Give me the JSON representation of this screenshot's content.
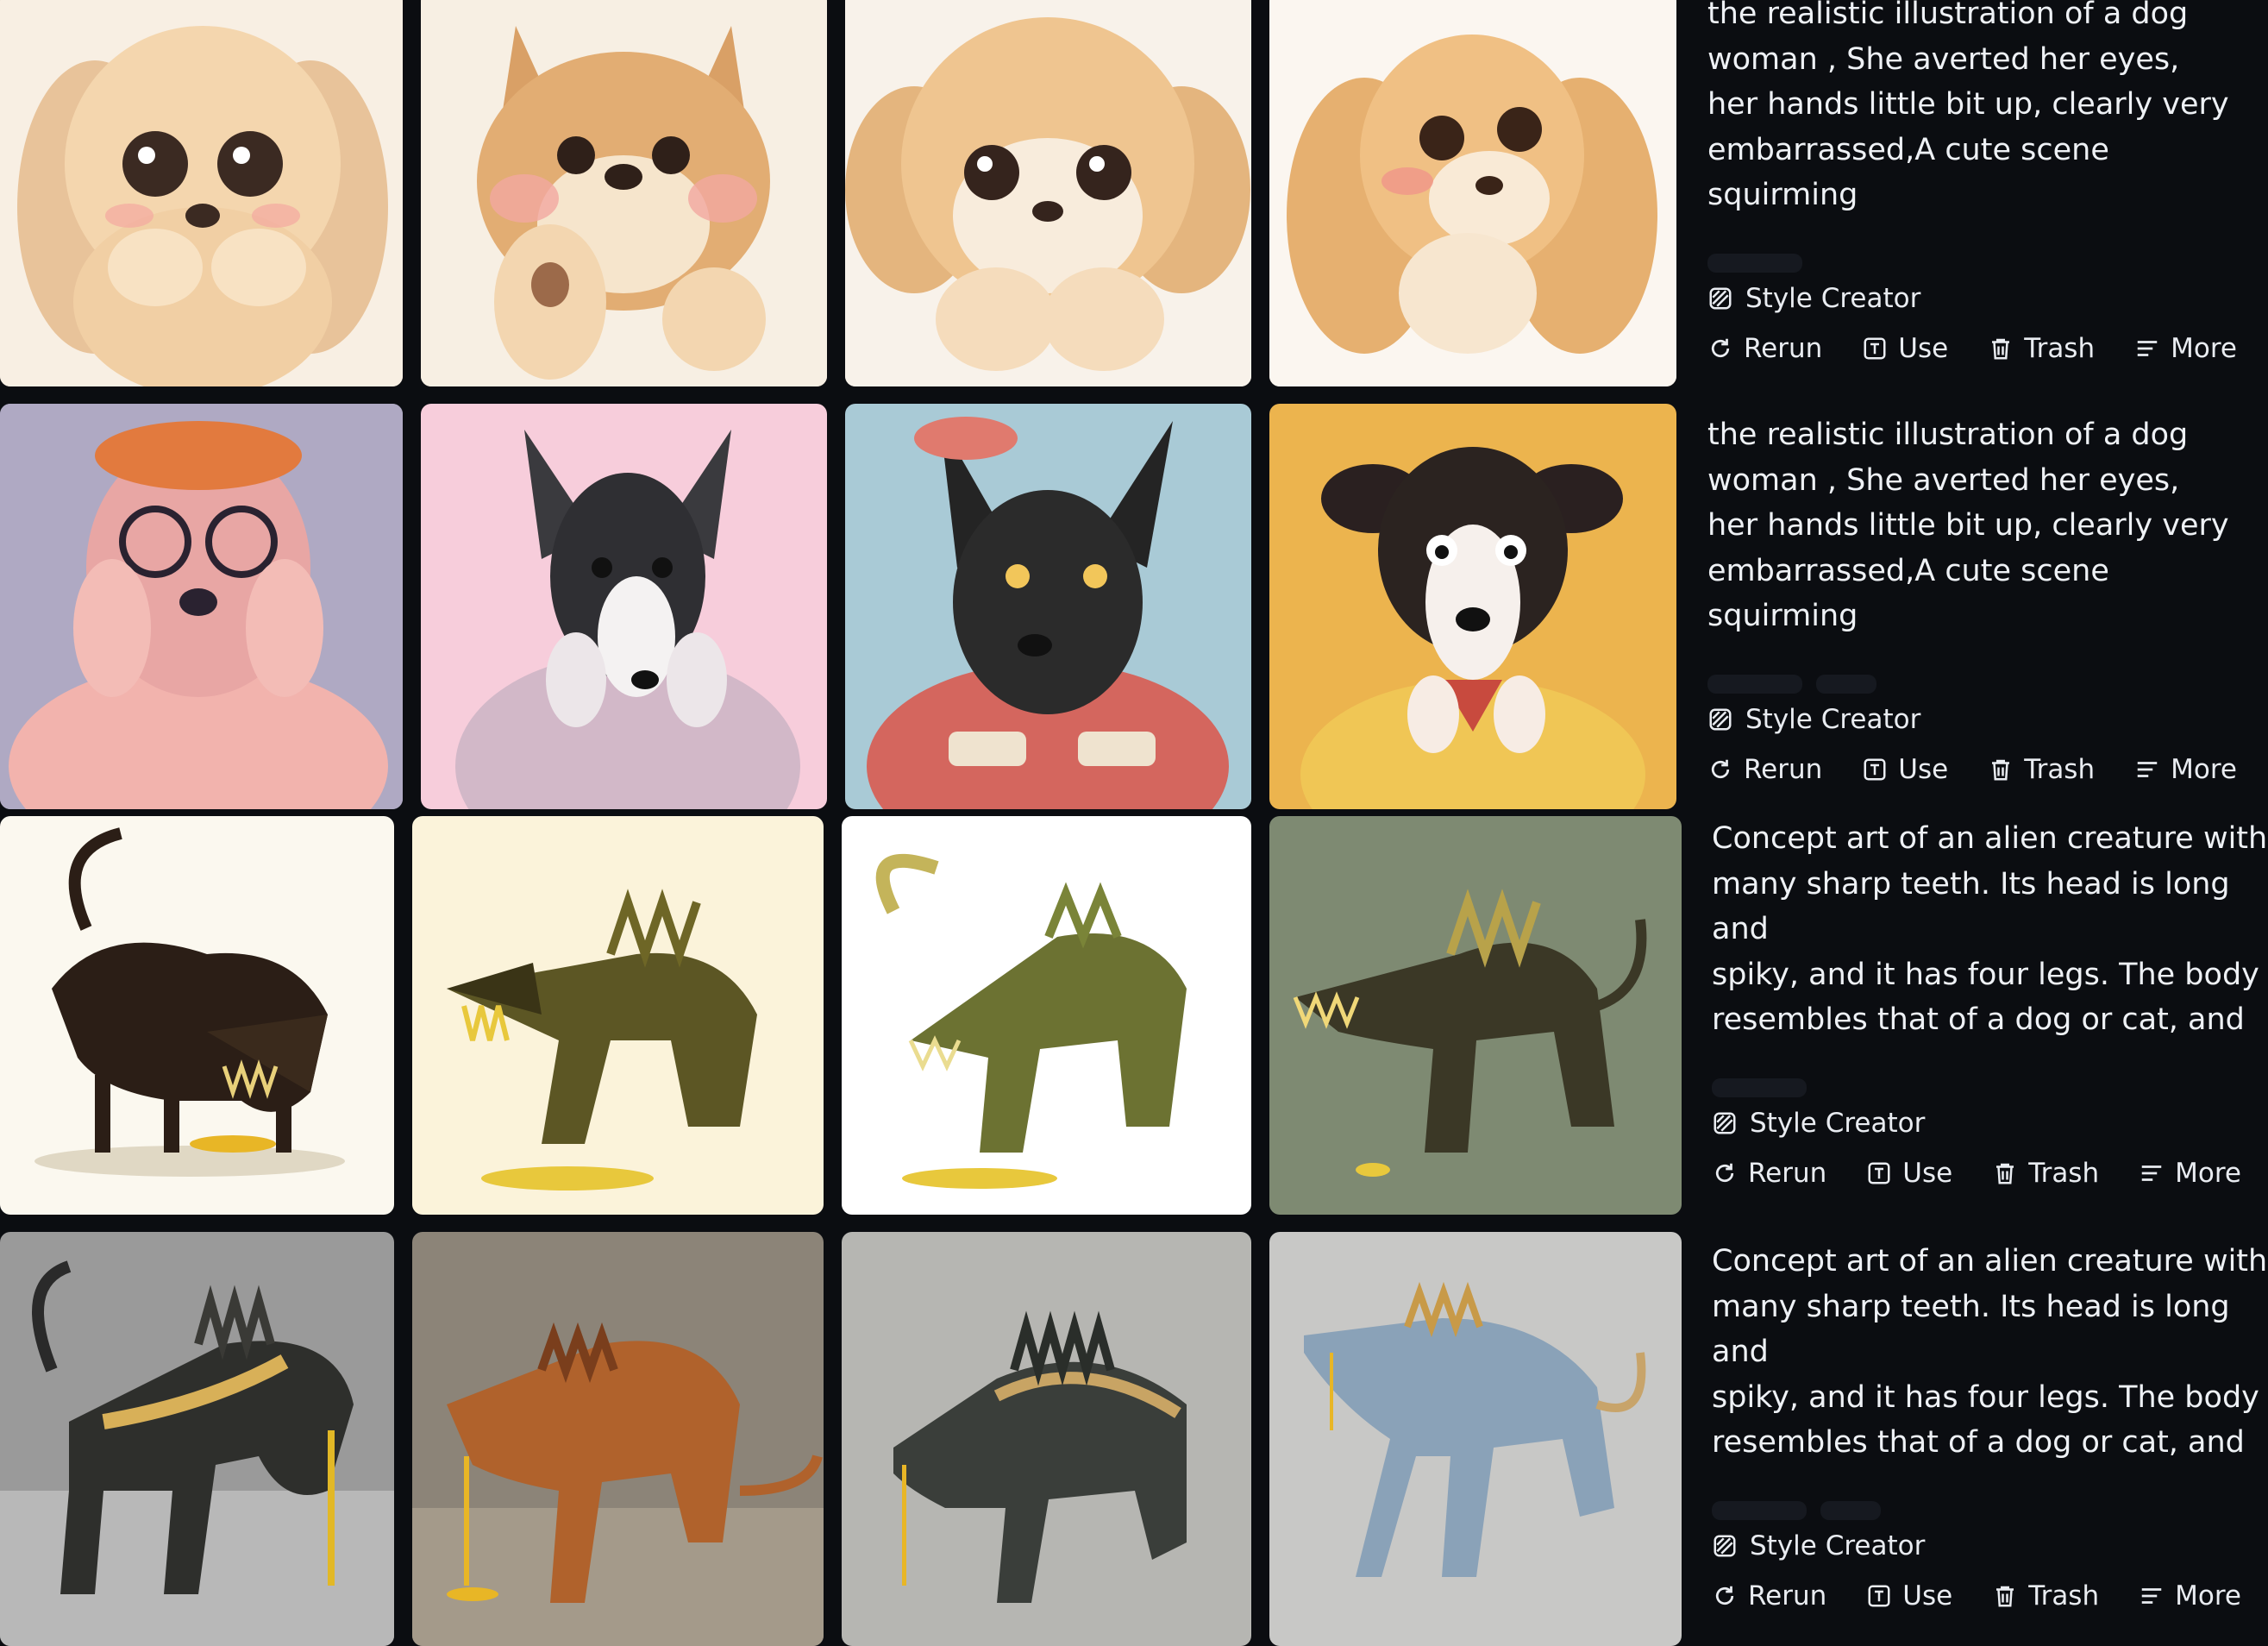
{
  "colors": {
    "background": "#0b0d11",
    "text": "#eef1f5"
  },
  "rows": [
    {
      "prompt": "the realistic illustration of a dog\nwoman , She averted her eyes,\nher hands little bit up, clearly very\nembarrassed,A cute scene squirming\nwith embarrassment,Her cheeks flush a",
      "style": "Style Creator",
      "actions": {
        "rerun": "Rerun",
        "use": "Use",
        "trash": "Trash",
        "more": "More"
      }
    },
    {
      "prompt": "the realistic illustration of a dog\nwoman , She averted her eyes,\nher hands little bit up, clearly very\nembarrassed,A cute scene squirming\nwith embarrassment,Her cheeks flush a",
      "style": "Style Creator",
      "actions": {
        "rerun": "Rerun",
        "use": "Use",
        "trash": "Trash",
        "more": "More"
      }
    },
    {
      "prompt": "Concept art of an alien creature with\nmany sharp teeth. Its head is long and\nspiky, and it has four legs. The body\nresembles that of a dog or cat, and\nits skin looks like chitinous scales. It is.",
      "style": "Style Creator",
      "actions": {
        "rerun": "Rerun",
        "use": "Use",
        "trash": "Trash",
        "more": "More"
      }
    },
    {
      "prompt": "Concept art of an alien creature with\nmany sharp teeth. Its head is long and\nspiky, and it has four legs. The body\nresembles that of a dog or cat, and\nits skin looks like chitinous scales. It is.",
      "style": "Style Creator",
      "actions": {
        "rerun": "Rerun",
        "use": "Use",
        "trash": "Trash",
        "more": "More"
      }
    }
  ]
}
